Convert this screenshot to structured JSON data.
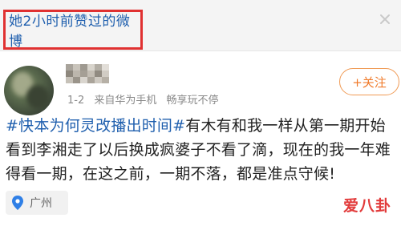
{
  "header": {
    "title": "她2小时前赞过的微博"
  },
  "post": {
    "date": "1-2",
    "client": "来自华为手机",
    "tail_text": "畅享玩不停",
    "follow_label": "+关注",
    "topic": "#快本为何灵改播出时间#",
    "body": "有木有和我一样从第一期开始看到李湘走了以后换成疯婆子不看了滴，现在的我一年难得看一期，在这之前，一期不落，都是准点守候!",
    "location": "广州"
  },
  "watermark": {
    "text": "爱八卦"
  },
  "colors": {
    "link_blue": "#1f5fae",
    "highlight_red": "#e03131",
    "follow_orange": "#f07a2a",
    "watermark_red": "#e23b3b"
  },
  "icons": {
    "location": "map-pin-icon",
    "close": "close-icon"
  }
}
